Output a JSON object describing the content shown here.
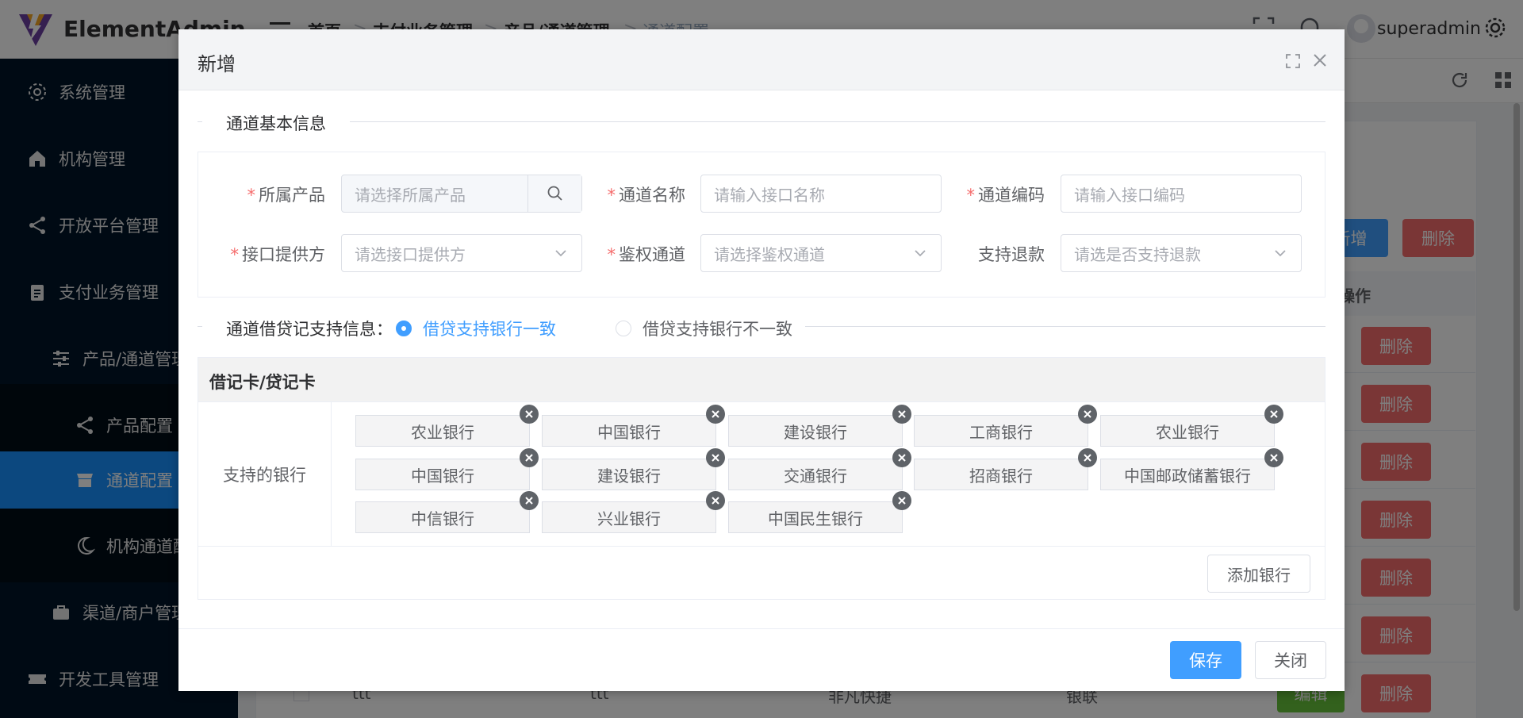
{
  "app": {
    "name": "ElementAdmin",
    "username": "superadmin"
  },
  "breadcrumb": [
    "首页",
    "支付业务管理",
    "产品/通道管理",
    "通道配置"
  ],
  "sidebar": {
    "items": [
      {
        "label": "系统管理",
        "icon": "gear-icon"
      },
      {
        "label": "机构管理",
        "icon": "home-icon"
      },
      {
        "label": "开放平台管理",
        "icon": "share-icon"
      },
      {
        "label": "支付业务管理",
        "icon": "clipboard-icon"
      },
      {
        "label": "产品/通道管理",
        "icon": "sliders-icon"
      },
      {
        "label": "产品配置",
        "icon": "share-icon"
      },
      {
        "label": "通道配置",
        "icon": "shop-icon",
        "active": true
      },
      {
        "label": "机构通道配",
        "icon": "moon-icon"
      },
      {
        "label": "渠道/商户管理",
        "icon": "briefcase-icon"
      },
      {
        "label": "开发工具管理",
        "icon": "ticket-icon"
      }
    ]
  },
  "background": {
    "add_label": "新增",
    "delete_label": "删除",
    "edit_label": "编辑",
    "ops_header": "操作",
    "last_row": [
      "ttt",
      "ttt",
      "非凡快捷",
      "银联"
    ]
  },
  "dialog": {
    "title": "新增",
    "section1_title": "通道基本信息",
    "fields": {
      "product": {
        "label": "所属产品",
        "placeholder": "请选择所属产品"
      },
      "channel_name": {
        "label": "通道名称",
        "placeholder": "请输入接口名称"
      },
      "channel_code": {
        "label": "通道编码",
        "placeholder": "请输入接口编码"
      },
      "provider": {
        "label": "接口提供方",
        "placeholder": "请选接口提供方"
      },
      "auth_channel": {
        "label": "鉴权通道",
        "placeholder": "请选择鉴权通道"
      },
      "refund": {
        "label": "支持退款",
        "placeholder": "请选是否支持退款"
      }
    },
    "section2_label": "通道借贷记支持信息：",
    "radio_consistent": "借贷支持银行一致",
    "radio_inconsistent": "借贷支持银行不一致",
    "card_header": "借记卡/贷记卡",
    "supported_banks_label": "支持的银行",
    "banks": [
      "农业银行",
      "中国银行",
      "建设银行",
      "工商银行",
      "农业银行",
      "中国银行",
      "建设银行",
      "交通银行",
      "招商银行",
      "中国邮政储蓄银行",
      "中信银行",
      "兴业银行",
      "中国民生银行"
    ],
    "add_bank_label": "添加银行",
    "save_label": "保存",
    "close_label": "关闭"
  },
  "colors": {
    "primary": "#409eff",
    "danger": "#f56c6c",
    "success": "#67c23a",
    "sidebar": "#001529",
    "sidebar_active": "#1890ff"
  }
}
